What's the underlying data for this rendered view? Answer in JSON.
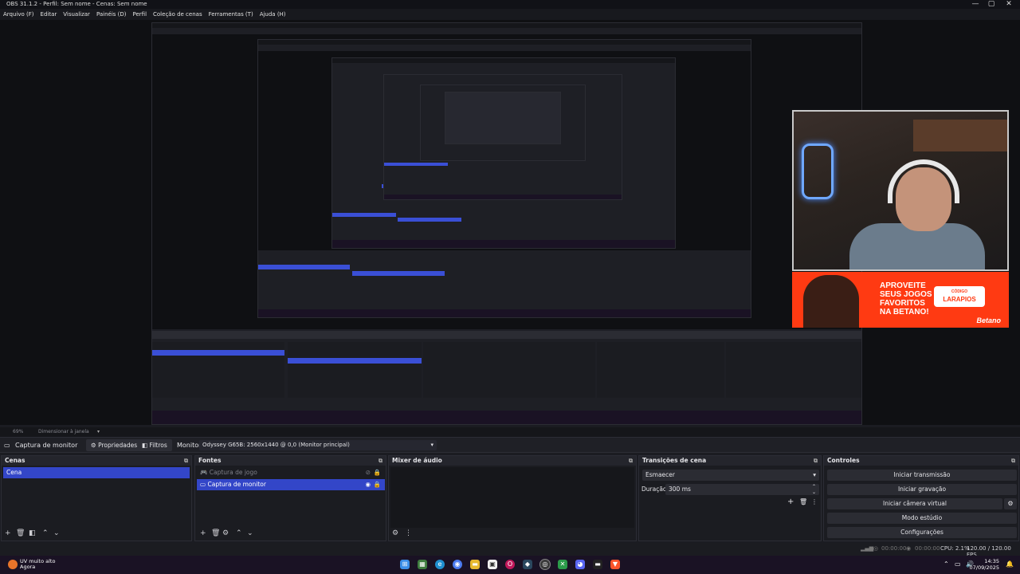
{
  "window": {
    "title": "OBS 31.1.2 - Perfil: Sem nome - Cenas: Sem nome",
    "minimize": "—",
    "maximize": "▢",
    "close": "✕"
  },
  "menu": [
    "Arquivo (F)",
    "Editar",
    "Visualizar",
    "Painéis (D)",
    "Perfil",
    "Coleção de cenas",
    "Ferramentas (T)",
    "Ajuda (H)"
  ],
  "banner": {
    "headline": "APROVEITE SEUS JOGOS FAVORITOS NA BETANO!",
    "code_label": "CÓDIGO",
    "code": "LARAPIOS",
    "brand": "Betano"
  },
  "zoom": {
    "percent": "69%",
    "mode": "Dimensionar à janela"
  },
  "context": {
    "source": "Captura de monitor",
    "properties": "Propriedades",
    "filters": "Filtros",
    "monitor_label": "Monitor",
    "monitor_value": "Odyssey G65B: 2560x1440 @ 0,0 (Monitor principal)"
  },
  "docks": {
    "scenes": {
      "title": "Cenas",
      "items": [
        "Cena"
      ]
    },
    "sources": {
      "title": "Fontes",
      "items": [
        "Captura de jogo",
        "Captura de monitor"
      ]
    },
    "mixer": {
      "title": "Mixer de áudio"
    },
    "transitions": {
      "title": "Transições de cena",
      "type": "Esmaecer",
      "duration_label": "Duração",
      "duration_value": "300 ms"
    },
    "controls": {
      "title": "Controles",
      "buttons": [
        "Iniciar transmissão",
        "Iniciar gravação",
        "Iniciar câmera virtual",
        "Modo estúdio",
        "Configurações"
      ]
    }
  },
  "status": {
    "stream_time": "00:00:00",
    "rec_time": "00:00:00",
    "cpu": "CPU: 2.1%",
    "fps": "120.00 / 120.00 FPS"
  },
  "taskbar": {
    "weather_title": "UV muito alto",
    "weather_sub": "Agora",
    "time": "14:35",
    "date": "07/09/2025"
  },
  "colors": {
    "accent": "#3346c8",
    "banner": "#ff3a12",
    "background": "#1b1c21"
  }
}
